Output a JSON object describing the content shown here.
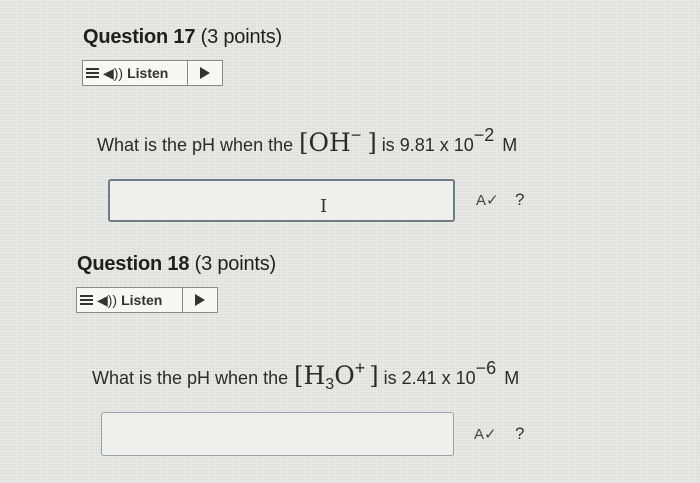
{
  "questions": [
    {
      "title": "Question 17",
      "points": "(3 points)",
      "listen_label": "Listen",
      "text_prefix": "What is the pH when the",
      "species": "OH",
      "charge": "−",
      "text_suffix": "is 9.81 x 10",
      "exponent": "−2",
      "unit": "M",
      "answer_value": "",
      "help": "?"
    },
    {
      "title": "Question 18",
      "points": "(3 points)",
      "listen_label": "Listen",
      "text_prefix": "What is the pH when the",
      "species_main": "H",
      "species_sub": "3",
      "species_rest": "O",
      "charge": "+",
      "text_suffix": "is 2.41 x 10",
      "exponent": "−6",
      "unit": "M",
      "answer_value": "",
      "help": "?"
    }
  ],
  "icons": {
    "menu": "menu-icon",
    "speaker": "speaker-icon",
    "play": "play-icon",
    "spellcheck": "spellcheck-icon",
    "help": "help-icon",
    "text_cursor": "text-cursor-icon"
  }
}
